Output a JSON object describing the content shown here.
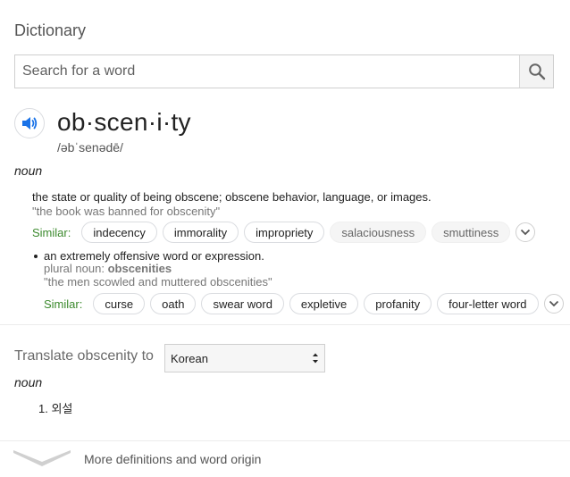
{
  "header": {
    "title": "Dictionary"
  },
  "search": {
    "placeholder": "Search for a word",
    "value": ""
  },
  "entry": {
    "headword": "ob·scen·i·ty",
    "phonetic": "/əbˈsenədē/",
    "part_of_speech": "noun",
    "senses": [
      {
        "definition": "the state or quality of being obscene; obscene behavior, language, or images.",
        "example": "\"the book was banned for obscenity\"",
        "similar_label": "Similar:",
        "similar": [
          "indecency",
          "immorality",
          "impropriety",
          "salaciousness",
          "smuttiness"
        ]
      },
      {
        "definition": "an extremely offensive word or expression.",
        "plural_label": "plural noun:",
        "plural_value": "obscenities",
        "example": "\"the men scowled and muttered obscenities\"",
        "similar_label": "Similar:",
        "similar": [
          "curse",
          "oath",
          "swear word",
          "expletive",
          "profanity",
          "four-letter word"
        ]
      }
    ]
  },
  "translate": {
    "label": "Translate obscenity to",
    "language": "Korean",
    "part_of_speech": "noun",
    "items": [
      "1. 외설"
    ]
  },
  "footer": {
    "more_label": "More definitions and word origin"
  },
  "colors": {
    "similar_label": "#3c8a2e",
    "audio_icon": "#1a73e8"
  }
}
